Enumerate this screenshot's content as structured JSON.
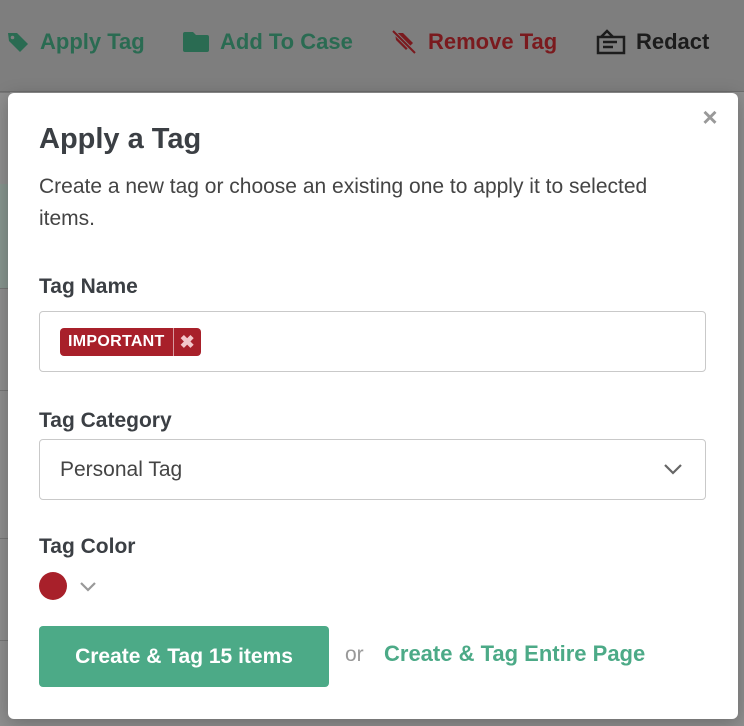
{
  "toolbar": {
    "apply_tag": {
      "label": "Apply Tag",
      "icon": "tag-icon",
      "color": "#2a6b52"
    },
    "add_to_case": {
      "label": "Add To Case",
      "icon": "folder-icon",
      "color": "#2a6b52"
    },
    "remove_tag": {
      "label": "Remove Tag",
      "icon": "tag-slash-icon",
      "color": "#7a1a1e"
    },
    "redact": {
      "label": "Redact",
      "icon": "redact-icon",
      "color": "#1c1c1c"
    }
  },
  "modal": {
    "close_icon": "×",
    "title": "Apply a Tag",
    "description": "Create a new tag or choose an existing one to apply it to selected items.",
    "tag_name": {
      "label": "Tag Name",
      "tags": [
        {
          "text": "IMPORTANT",
          "color": "#a8202a",
          "remove_icon": "✖"
        }
      ]
    },
    "tag_category": {
      "label": "Tag Category",
      "selected": "Personal Tag"
    },
    "tag_color": {
      "label": "Tag Color",
      "value": "#a8202a"
    },
    "actions": {
      "primary": "Create & Tag 15 items",
      "or": "or",
      "secondary": "Create & Tag Entire Page"
    },
    "accent_color": "#4caa87"
  }
}
